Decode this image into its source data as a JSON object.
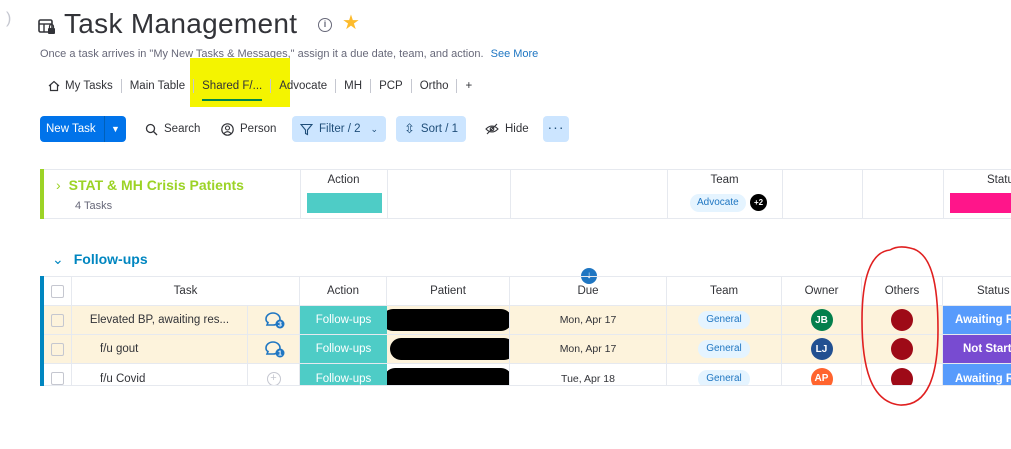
{
  "header": {
    "title": "Task Management",
    "description": "Once a task arrives in \"My New Tasks & Messages,\" assign it a due date, team, and action.",
    "see_more": "See More"
  },
  "tabs": [
    {
      "label": "My Tasks",
      "icon": "home-icon"
    },
    {
      "label": "Main Table"
    },
    {
      "label": "Shared F/...",
      "active": true
    },
    {
      "label": "Advocate"
    },
    {
      "label": "MH"
    },
    {
      "label": "PCP"
    },
    {
      "label": "Ortho"
    },
    {
      "label": "+"
    }
  ],
  "toolbar": {
    "new_task": "New Task",
    "search": "Search",
    "person": "Person",
    "filter": "Filter / 2",
    "sort": "Sort / 1",
    "hide": "Hide",
    "more": "···"
  },
  "groups": [
    {
      "title": "STAT & MH Crisis Patients",
      "count": "4 Tasks",
      "color": "#9cd326",
      "collapsed": true,
      "columns": {
        "action": "Action",
        "team": "Team",
        "status": "Status"
      },
      "team_pill": "Advocate",
      "team_extra": "+2",
      "action_color": "#4eccc6",
      "status_color": "#ff158a"
    },
    {
      "title": "Follow-ups",
      "color": "#0086c0",
      "collapsed": false,
      "columns": [
        "Task",
        "Action",
        "Patient",
        "Due",
        "Team",
        "Owner",
        "Others",
        "Status"
      ],
      "rows": [
        {
          "task": "Elevated BP, awaiting res...",
          "updates": "3",
          "action": "Follow-ups",
          "due": "Mon, Apr 17",
          "team": "General",
          "owner": "JB",
          "owner_color": "#037f4c",
          "status": "Awaiting R",
          "status_color": "#579bfc"
        },
        {
          "task": "f/u gout",
          "updates": "1",
          "action": "Follow-ups",
          "due": "Mon, Apr 17",
          "team": "General",
          "owner": "LJ",
          "owner_color": "#225091",
          "status": "Not Start",
          "status_color": "#784bd1"
        },
        {
          "task": "f/u Covid",
          "updates": "",
          "action": "Follow-ups",
          "due": "Tue, Apr 18",
          "team": "General",
          "owner": "AP",
          "owner_color": "#ff642e",
          "status": "Awaiting R",
          "status_color": "#579bfc"
        }
      ]
    }
  ],
  "colors": {
    "accent": "#0073ea",
    "highlight": "#f4f400",
    "others_avatar": "#9e0a17",
    "annotation": "#e02020"
  }
}
